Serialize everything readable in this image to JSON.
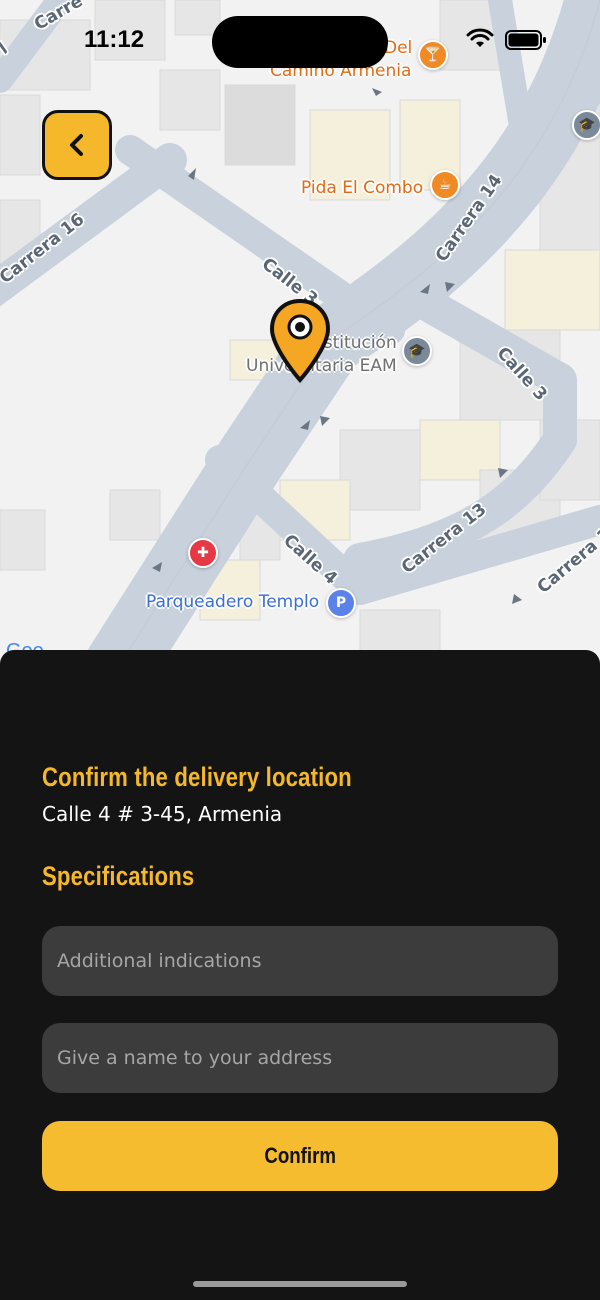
{
  "status_bar": {
    "time": "11:12"
  },
  "map": {
    "streets": {
      "carrera_16": "Carrera 16",
      "calle_3_upper": "Calle 3",
      "carrera_14": "Carrera 14",
      "calle_3_right": "Calle 3",
      "calle_4": "Calle 4",
      "carrera_13": "Carrera 13",
      "carrera_partial_right": "Carrera 1",
      "carrera_partial_top": "Carre",
      "carrera_partial_left": "7"
    },
    "pois": {
      "camino_line1": "Del",
      "camino_line2": "Camino Armenia",
      "pida_el_combo": "Pida El Combo",
      "eam_line1": "Institución",
      "eam_line2": "Universitaria EAM",
      "parqueadero": "Parqueadero Templo",
      "parking_glyph": "P"
    },
    "google_logo": "Goo"
  },
  "sheet": {
    "confirm_title": "Confirm the delivery location",
    "address": "Calle 4 # 3-45, Armenia",
    "specifications_title": "Specifications",
    "indications_placeholder": "Additional indications",
    "name_placeholder": "Give a name to your address",
    "confirm_label": "Confirm"
  },
  "colors": {
    "accent": "#f5b82a",
    "sheet_bg": "#141414",
    "field_bg": "#3c3c3c"
  },
  "icons": {
    "back": "chevron-left-icon",
    "pin": "location-pin-icon",
    "wifi": "wifi-icon",
    "battery": "battery-icon"
  }
}
